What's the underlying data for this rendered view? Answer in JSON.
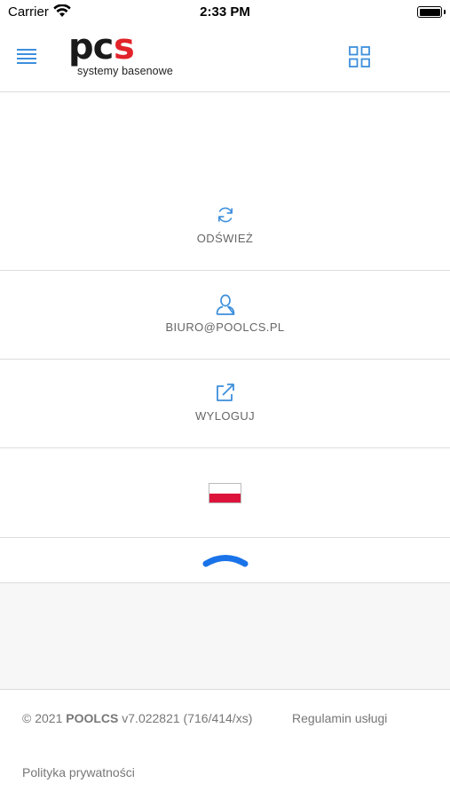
{
  "status_bar": {
    "carrier": "Carrier",
    "time": "2:33 PM"
  },
  "header": {
    "logo_text": "pcs",
    "logo_tagline": "systemy basenowe",
    "menu_icon": "hamburger-icon",
    "apps_icon": "grid-icon",
    "accent_color": "#3d8fdc",
    "brand_red": "#e2232a"
  },
  "menu": {
    "refresh": {
      "label": "ODŚWIEŻ",
      "icon": "refresh-icon"
    },
    "account": {
      "label": "BIURO@POOLCS.PL",
      "icon": "user-icon"
    },
    "logout": {
      "label": "WYLOGUJ",
      "icon": "external-link-icon"
    },
    "language": {
      "icon": "poland-flag-icon"
    },
    "collapse": {
      "icon": "chevron-up-icon"
    }
  },
  "footer": {
    "copyright_prefix": "© 2021 ",
    "brand": "POOLCS",
    "version": " v7.022821 (716/414/xs)",
    "terms": "Regulamin usługi",
    "privacy": "Polityka prywatności"
  }
}
